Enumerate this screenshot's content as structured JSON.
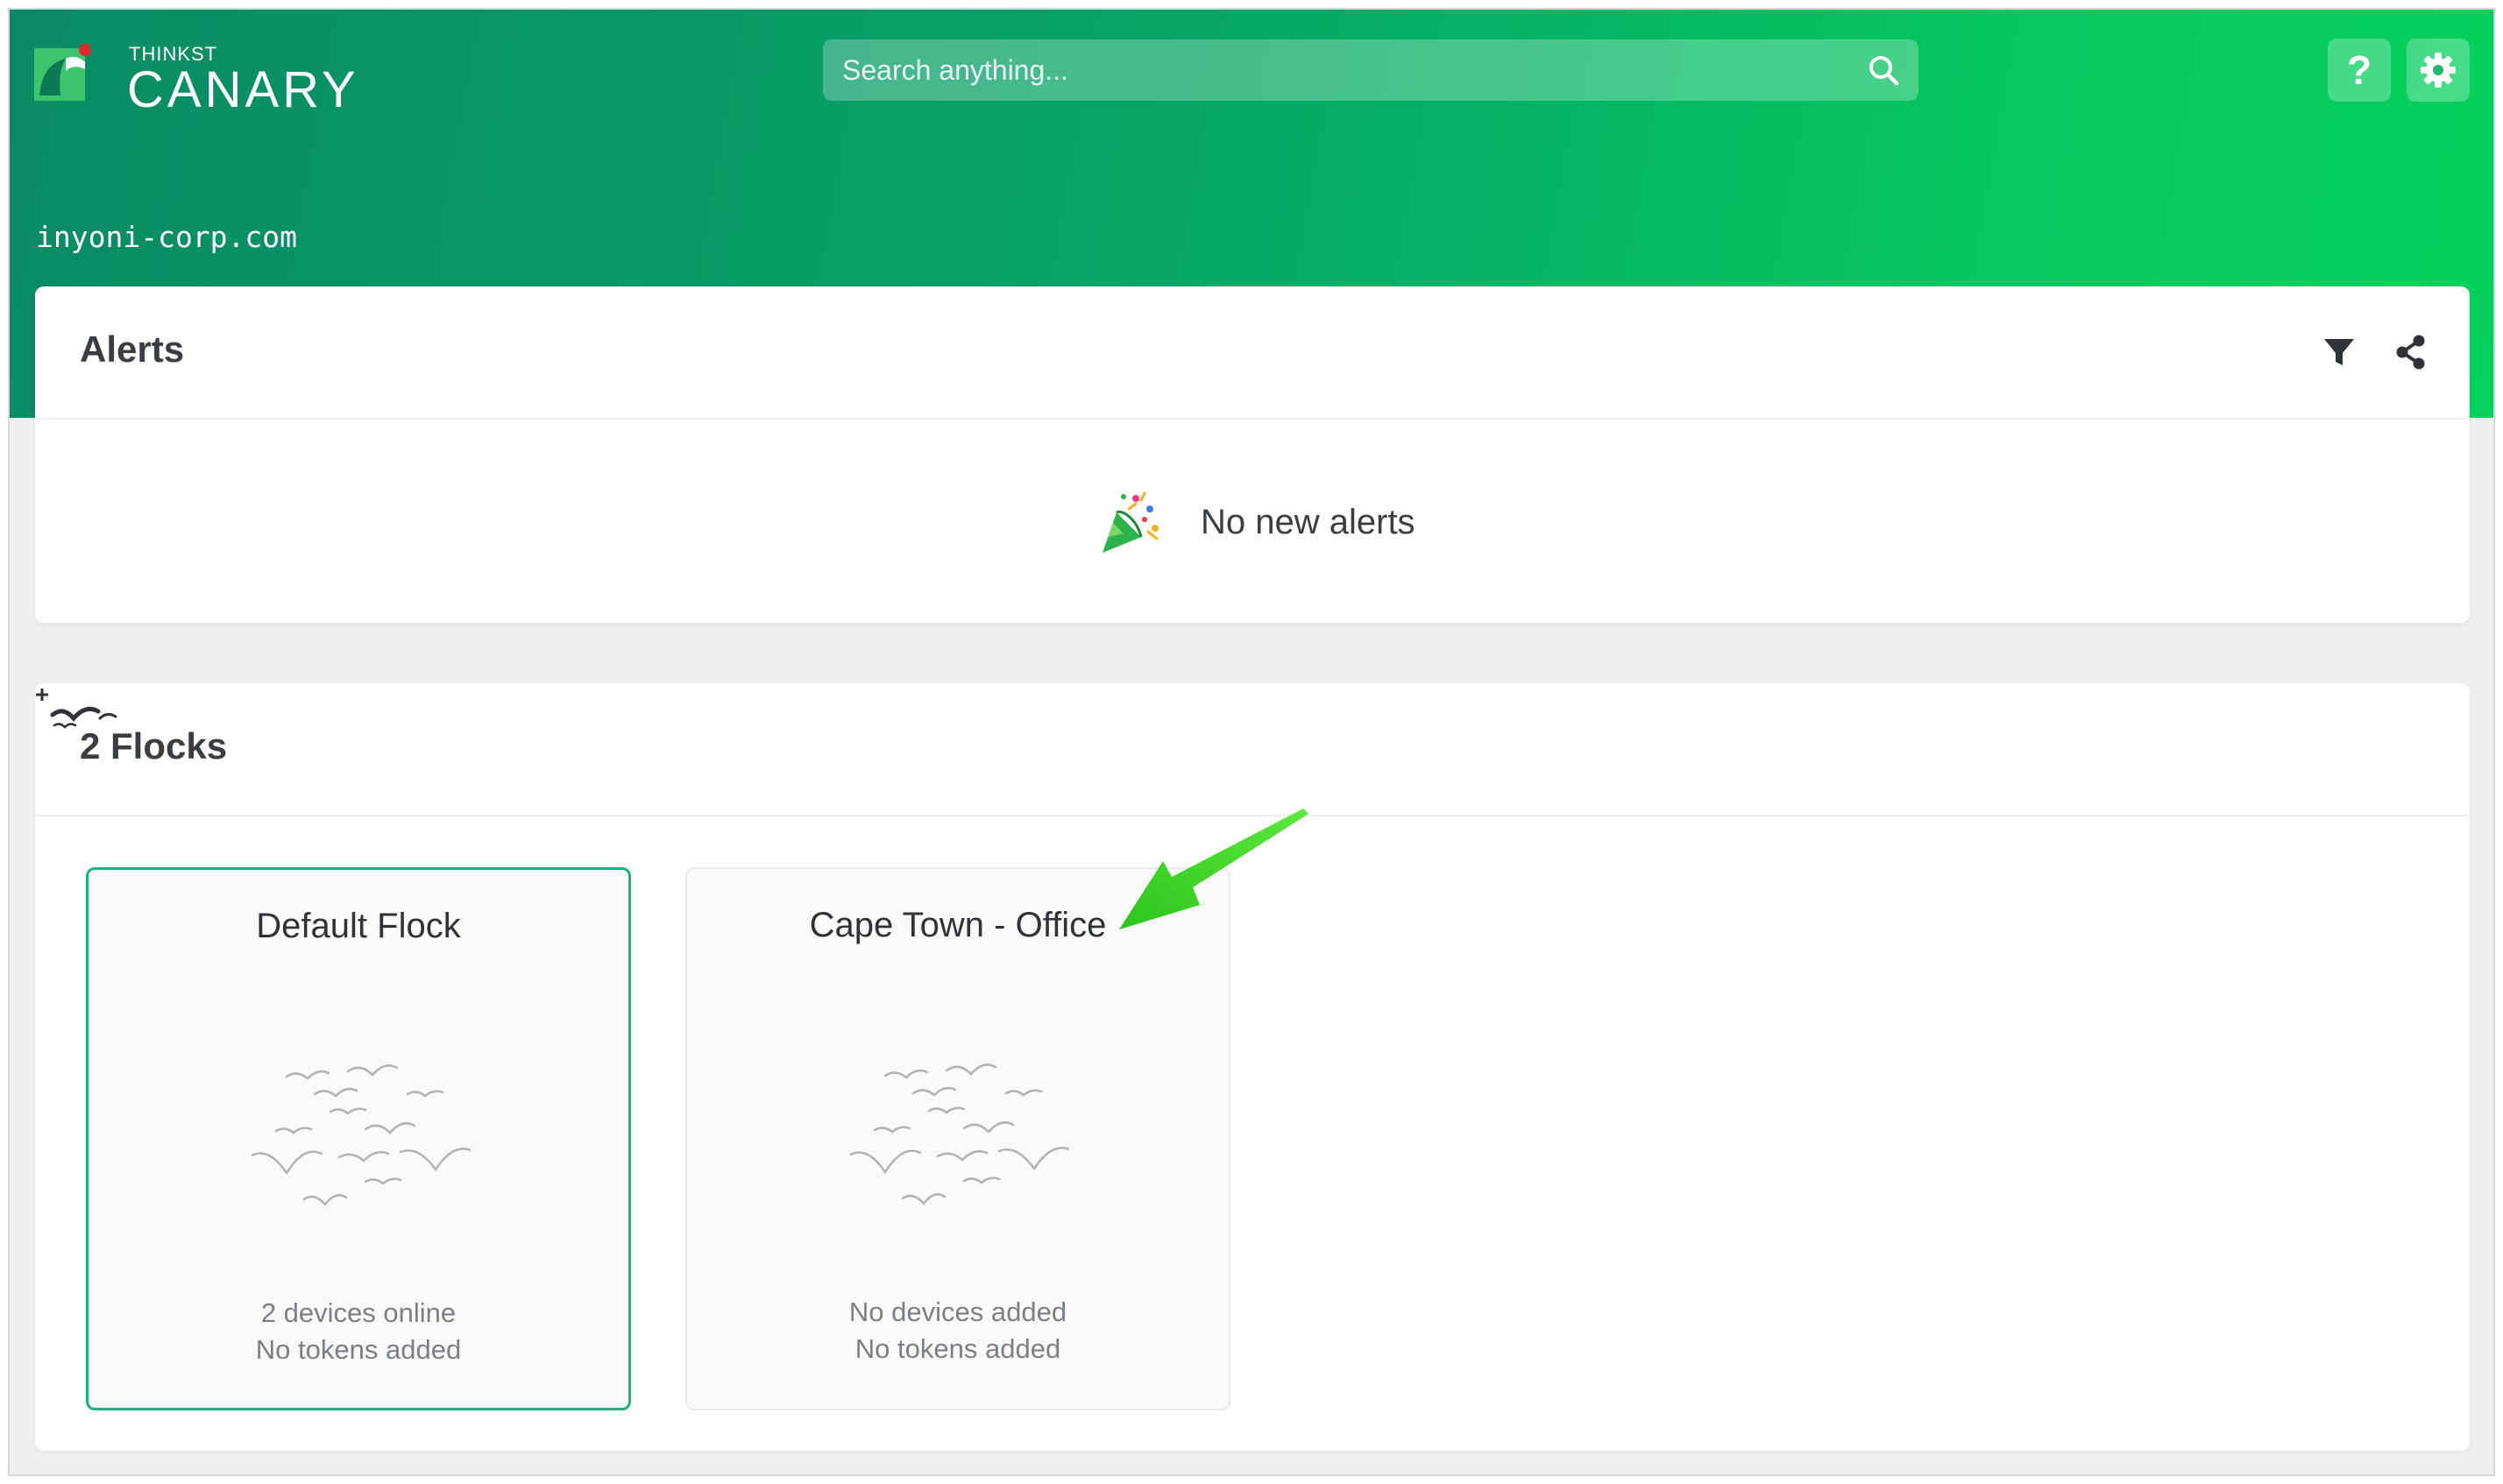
{
  "app": {
    "logo_top": "THINKST",
    "logo_main": "CANARY",
    "logo_icon": "canary-logo-icon",
    "brand_colors": {
      "header_start": "#0a8a64",
      "header_end": "#05d15c",
      "accent": "#1ab57a"
    }
  },
  "search": {
    "placeholder": "Search anything...",
    "value": ""
  },
  "header": {
    "domain": "inyoni-corp.com",
    "help_label": "?",
    "help_icon": "question-icon",
    "settings_icon": "gear-icon"
  },
  "alerts": {
    "title": "Alerts",
    "empty_text": "No new alerts",
    "empty_icon": "party-popper-icon",
    "filter_icon": "filter-icon",
    "share_icon": "share-icon"
  },
  "flocks": {
    "title": "2 Flocks",
    "add_icon": "add-flock-icon",
    "items": [
      {
        "name": "Default Flock",
        "line1": "2 devices online",
        "line2": "No tokens added",
        "selected": true
      },
      {
        "name": "Cape Town - Office",
        "line1": "No devices added",
        "line2": "No tokens added",
        "selected": false
      }
    ]
  },
  "annotation": {
    "arrow_color": "#3ed62a",
    "arrow_icon": "annotation-arrow"
  }
}
